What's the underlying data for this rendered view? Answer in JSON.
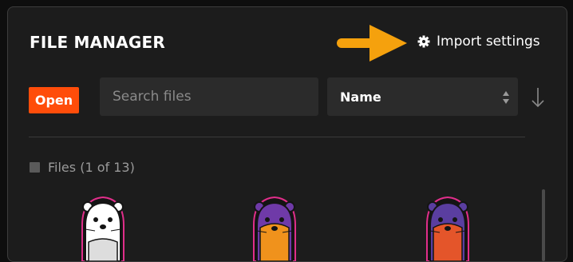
{
  "window": {
    "title": "FILE MANAGER"
  },
  "header": {
    "import_label": "Import settings",
    "import_icon": "gear-icon",
    "hint": "arrow-right-icon"
  },
  "toolbar": {
    "open_label": "Open",
    "search_placeholder": "Search files",
    "sort_value": "Name",
    "sort_direction_icon": "arrow-down-icon"
  },
  "files": {
    "label": "Files (1 of 13)",
    "items": [
      {
        "name": "otter-white",
        "body": "#ffffff",
        "belly": "#dddddd"
      },
      {
        "name": "otter-purple-orange",
        "body": "#6f3aa8",
        "belly": "#f0921c"
      },
      {
        "name": "otter-purple-red",
        "body": "#5a3ea0",
        "belly": "#e4552a"
      }
    ]
  },
  "colors": {
    "accent": "#ff4d0a",
    "hint_arrow": "#f5a10d",
    "outline": "#e02e8a"
  }
}
